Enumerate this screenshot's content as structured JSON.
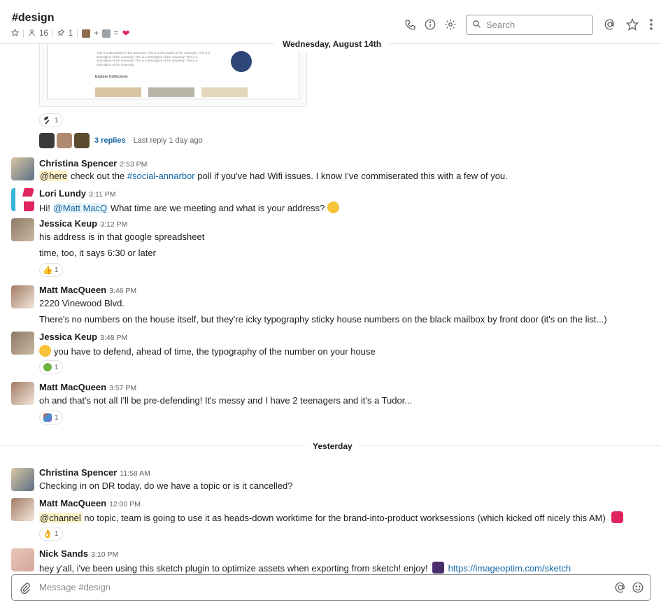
{
  "channel": {
    "name": "#design",
    "members": "16",
    "pinned": "1",
    "topic_plus": "+",
    "topic_eq": "="
  },
  "header": {
    "search_placeholder": "Search",
    "icons": [
      "phone-icon",
      "info-icon",
      "gear-icon",
      "search-icon",
      "at-icon",
      "star-icon",
      "more-icon"
    ]
  },
  "date_top": "Wednesday, August 14th",
  "attachment": {
    "caption_text": "This is a description of the university. This is a description of the university. This is a description of the university. This is a description of the university. This is a description of the university. This is a description of the university. This is a description of the university.",
    "section_title": "Explore Collections"
  },
  "top_reaction": {
    "count": "1"
  },
  "thread": {
    "replies": "3 replies",
    "last": "Last reply 1 day ago"
  },
  "messages": [
    {
      "name": "Christina Spencer",
      "time": "2:53 PM",
      "mention": "@here",
      "pre": " check out the ",
      "channel_link": "#social-annarbor",
      "post": " poll if you've had Wifi issues. I know I've commiserated this with a few of you."
    },
    {
      "name": "Lori Lundy",
      "time": "3:11 PM",
      "pre": "Hi! ",
      "mention": "@Matt MacQ",
      "post": " What time are we meeting and what is your address?"
    },
    {
      "name": "Jessica Keup",
      "time": "3:12 PM",
      "line1": "his address is in that google spreadsheet",
      "line2": "time, too, it says 6:30 or later",
      "reaction_count": "1"
    },
    {
      "name": "Matt MacQueen",
      "time": "3:46 PM",
      "line1": "2220 Vinewood Blvd.",
      "line2": "There's no numbers on the house itself, but they're icky typography sticky house numbers on the black mailbox by front door (it's on the list...)"
    },
    {
      "name": "Jessica Keup",
      "time": "3:48 PM",
      "text": "you have to defend, ahead of time, the typography of the number on your house",
      "reaction_count": "1"
    },
    {
      "name": "Matt MacQueen",
      "time": "3:57 PM",
      "text": "oh and that's not all I'll be pre-defending!  It's messy and I have 2 teenagers and it's a Tudor...",
      "reaction_count": "1"
    },
    {
      "name": "Christina Spencer",
      "time": "11:58 AM",
      "text": "Checking in on DR today, do we have a topic or is it cancelled?"
    },
    {
      "name": "Matt MacQueen",
      "time": "12:00 PM",
      "mention": "@channel",
      "post": " no topic, team is going to use it as heads-down worktime for the brand-into-product worksessions (which kicked off nicely this AM)",
      "reaction_count": "1"
    },
    {
      "name": "Nick Sands",
      "time": "3:10 PM",
      "pre": "hey y'all, i've been using this sketch plugin to optimize assets when exporting from sketch! enjoy!",
      "url": "https://imageoptim.com/sketch"
    }
  ],
  "divider_yesterday": "Yesterday",
  "composer": {
    "placeholder": "Message #design"
  }
}
